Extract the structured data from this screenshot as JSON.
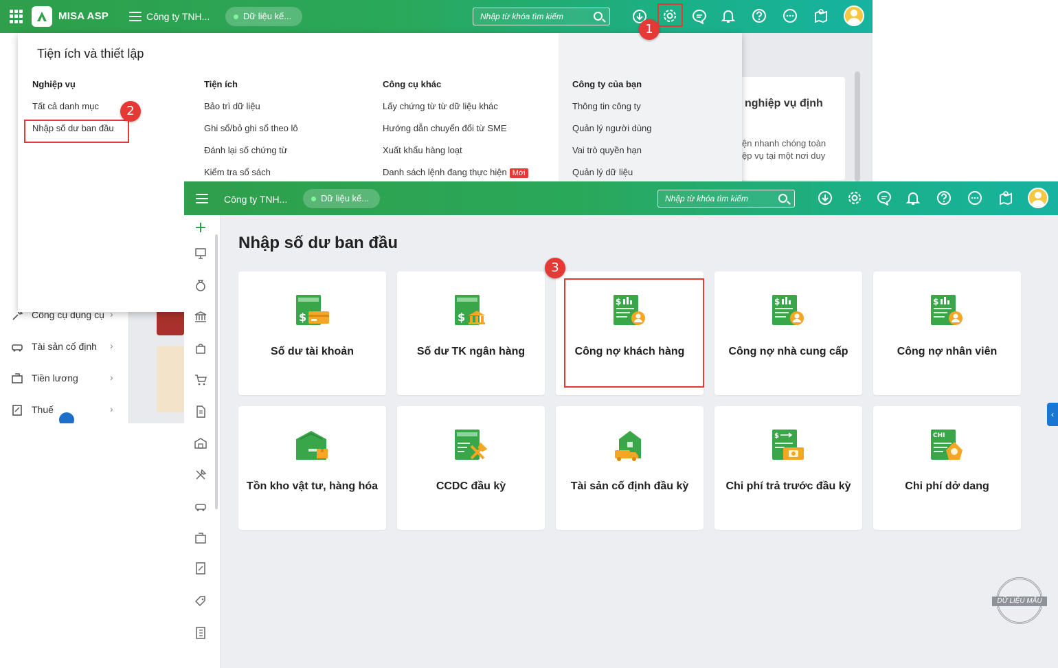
{
  "window_back": {
    "app_name": "MISA ASP",
    "company": "Công ty TNH...",
    "data_pill": "Dữ liệu kế...",
    "search_placeholder": "Nhập từ khóa tìm kiếm",
    "sidebar": [
      {
        "label": "Công cụ dụng cụ",
        "icon": "tools-icon"
      },
      {
        "label": "Tài sản cố định",
        "icon": "car-icon"
      },
      {
        "label": "Tiền lương",
        "icon": "salary-icon"
      },
      {
        "label": "Thuế",
        "icon": "tax-icon"
      }
    ],
    "bg_card": {
      "title": "nghiệp vụ định",
      "desc_line1": "ện nhanh chóng toàn",
      "desc_line2": "ệp vụ tại một nơi duy"
    }
  },
  "popup": {
    "title": "Tiện ích và thiết lập",
    "columns": [
      {
        "header": "Nghiệp vụ",
        "items": [
          "Tất cả danh mục",
          "Nhập số dư ban đầu"
        ]
      },
      {
        "header": "Tiện ích",
        "items": [
          "Bảo trì dữ liệu",
          "Ghi sổ/bỏ ghi sổ theo lô",
          "Đánh lại số chứng từ",
          "Kiểm tra sổ sách"
        ]
      },
      {
        "header": "Công cụ khác",
        "items": [
          "Lấy chứng từ từ dữ liệu khác",
          "Hướng dẫn chuyển đổi từ SME",
          "Xuất khẩu hàng loạt",
          "Danh sách lệnh đang thực hiện"
        ],
        "new_tag": "Mới"
      },
      {
        "header": "Công ty của bạn",
        "items": [
          "Thông tin công ty",
          "Quản lý người dùng",
          "Vai trò quyền hạn",
          "Quản lý dữ liệu"
        ]
      }
    ]
  },
  "badges": [
    "1",
    "2",
    "3"
  ],
  "window_front": {
    "company": "Công ty TNH...",
    "data_pill": "Dữ liệu kế...",
    "search_placeholder": "Nhập từ khóa tìm kiếm",
    "page_title": "Nhập số dư ban đầu",
    "cards": [
      {
        "label": "Số dư tài khoản",
        "icon": "account-balance-icon"
      },
      {
        "label": "Số dư TK ngân hàng",
        "icon": "bank-balance-icon"
      },
      {
        "label": "Công nợ khách hàng",
        "icon": "customer-debt-icon"
      },
      {
        "label": "Công nợ nhà cung cấp",
        "icon": "supplier-debt-icon"
      },
      {
        "label": "Công nợ nhân viên",
        "icon": "employee-debt-icon"
      },
      {
        "label": "Tồn kho vật tư, hàng hóa",
        "icon": "warehouse-icon"
      },
      {
        "label": "CCDC đầu kỳ",
        "icon": "tools-document-icon"
      },
      {
        "label": "Tài sản cố định đầu kỳ",
        "icon": "fixed-asset-icon"
      },
      {
        "label": "Chi phí trả trước đầu kỳ",
        "icon": "prepaid-expense-icon"
      },
      {
        "label": "Chi phí dở dang",
        "icon": "wip-cost-icon"
      }
    ],
    "wip_icon_text": "CHI",
    "stamp": "DỮ LIỆU MẪU"
  },
  "colors": {
    "brand_green": "#2e9f4a",
    "teal": "#16b3a0",
    "highlight_red": "#e53935",
    "icon_green": "#3aa64a",
    "icon_orange": "#f5a623"
  }
}
